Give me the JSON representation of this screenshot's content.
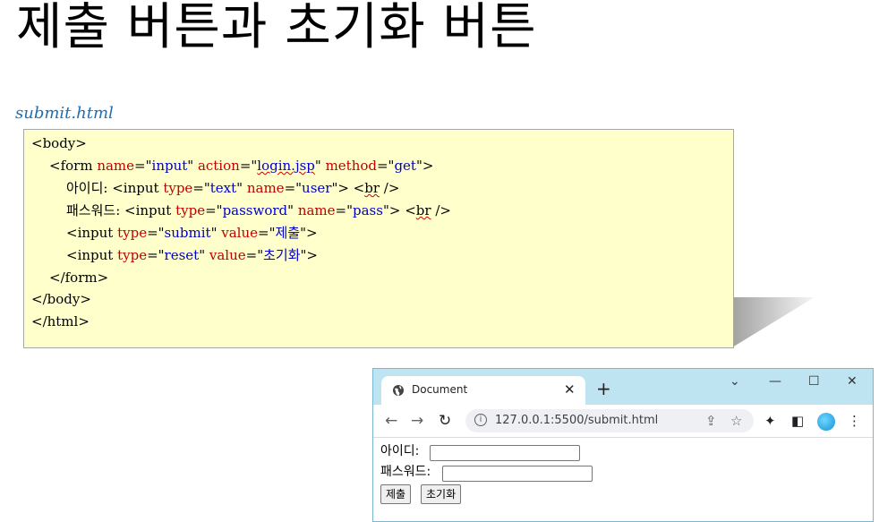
{
  "slide": {
    "title": "제출 버튼과 초기화 버튼",
    "filename": "submit.html"
  },
  "code": {
    "lines": [
      [
        {
          "t": "<body>",
          "c": "k"
        }
      ],
      [
        {
          "t": "<form ",
          "c": "k"
        },
        {
          "t": "name",
          "c": "a"
        },
        {
          "t": "=\"",
          "c": "k"
        },
        {
          "t": "input",
          "c": "v"
        },
        {
          "t": "\" ",
          "c": "k"
        },
        {
          "t": "action",
          "c": "a"
        },
        {
          "t": "=\"",
          "c": "k"
        },
        {
          "t": "login.jsp",
          "c": "v u"
        },
        {
          "t": "\" ",
          "c": "k"
        },
        {
          "t": "method",
          "c": "a"
        },
        {
          "t": "=\"",
          "c": "k"
        },
        {
          "t": "get",
          "c": "v"
        },
        {
          "t": "\">",
          "c": "k"
        }
      ],
      [
        {
          "t": "아이디: <input ",
          "c": "k"
        },
        {
          "t": "type",
          "c": "a"
        },
        {
          "t": "=\"",
          "c": "k"
        },
        {
          "t": "text",
          "c": "v"
        },
        {
          "t": "\" ",
          "c": "k"
        },
        {
          "t": "name",
          "c": "a"
        },
        {
          "t": "=\"",
          "c": "k"
        },
        {
          "t": "user",
          "c": "v"
        },
        {
          "t": "\"> <",
          "c": "k"
        },
        {
          "t": "br",
          "c": "k u"
        },
        {
          "t": " />",
          "c": "k"
        }
      ],
      [
        {
          "t": "패스워드: <input ",
          "c": "k"
        },
        {
          "t": "type",
          "c": "a"
        },
        {
          "t": "=\"",
          "c": "k"
        },
        {
          "t": "password",
          "c": "v"
        },
        {
          "t": "\" ",
          "c": "k"
        },
        {
          "t": "name",
          "c": "a"
        },
        {
          "t": "=\"",
          "c": "k"
        },
        {
          "t": "pass",
          "c": "v"
        },
        {
          "t": "\"> <",
          "c": "k"
        },
        {
          "t": "br",
          "c": "k u"
        },
        {
          "t": " />",
          "c": "k"
        }
      ],
      [
        {
          "t": "<input ",
          "c": "k"
        },
        {
          "t": "type",
          "c": "a"
        },
        {
          "t": "=\"",
          "c": "k"
        },
        {
          "t": "submit",
          "c": "v"
        },
        {
          "t": "\" ",
          "c": "k"
        },
        {
          "t": "value",
          "c": "a"
        },
        {
          "t": "=\"",
          "c": "k"
        },
        {
          "t": "제출",
          "c": "v"
        },
        {
          "t": "\">",
          "c": "k"
        }
      ],
      [
        {
          "t": "<input ",
          "c": "k"
        },
        {
          "t": "type",
          "c": "a"
        },
        {
          "t": "=\"",
          "c": "k"
        },
        {
          "t": "reset",
          "c": "v"
        },
        {
          "t": "\" ",
          "c": "k"
        },
        {
          "t": "value",
          "c": "a"
        },
        {
          "t": "=\"",
          "c": "k"
        },
        {
          "t": "초기화",
          "c": "v"
        },
        {
          "t": "\">",
          "c": "k"
        }
      ],
      [
        {
          "t": "</form>",
          "c": "k"
        }
      ],
      [
        {
          "t": "</body>",
          "c": "k"
        }
      ],
      [
        {
          "t": "</html>",
          "c": "k"
        }
      ]
    ]
  },
  "browser": {
    "tab_title": "Document",
    "tab_close": "✕",
    "new_tab": "+",
    "url": "127.0.0.1:5500/submit.html",
    "win_controls": [
      "⌄",
      "—",
      "☐",
      "✕"
    ],
    "nav": {
      "back": "←",
      "forward": "→",
      "reload": "↻"
    },
    "omni_icons": {
      "share": "⇪",
      "bookmark": "☆"
    },
    "toolbar_icons": {
      "extensions": "✦",
      "sidebar": "◧",
      "menu": "⋮"
    },
    "form": {
      "id_label": "아이디:",
      "pw_label": "패스워드:",
      "submit_label": "제출",
      "reset_label": "초기화"
    }
  }
}
